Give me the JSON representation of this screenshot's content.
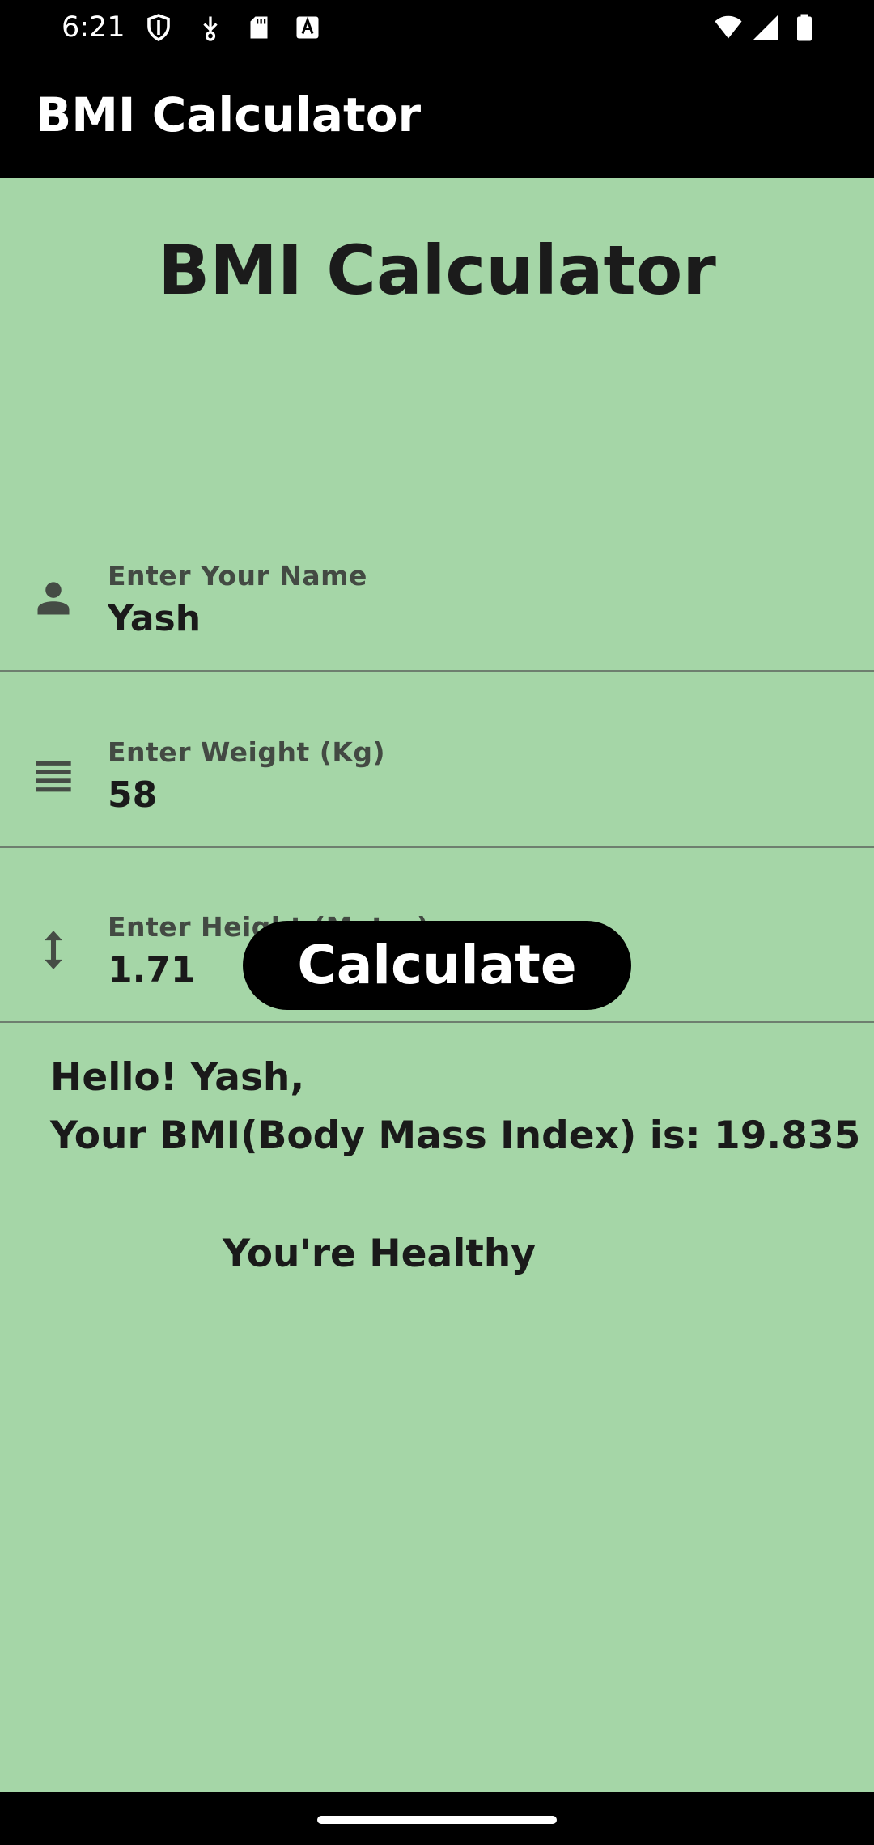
{
  "status_bar": {
    "time": "6:21",
    "left_icons": [
      "shield-icon",
      "usb-icon",
      "sd-card-icon",
      "text-icon"
    ],
    "right_icons": [
      "wifi-icon",
      "signal-icon",
      "battery-icon"
    ]
  },
  "app_bar": {
    "title": "BMI Calculator"
  },
  "main": {
    "title": "BMI Calculator",
    "fields": [
      {
        "label": "Enter Your Name",
        "value": "Yash",
        "icon": "person-icon"
      },
      {
        "label": "Enter Weight (Kg)",
        "value": "58",
        "icon": "weight-lines-icon"
      },
      {
        "label": "Enter Height (Meter)",
        "value": "1.71",
        "icon": "height-arrows-icon"
      }
    ],
    "calculate_label": "Calculate",
    "result": {
      "greeting": "Hello! Yash,",
      "bmi_line": "Your BMI(Body Mass Index) is: 19.835",
      "status": "You're Healthy"
    }
  },
  "colors": {
    "background": "#a5d6a7",
    "app_bar": "#000000",
    "button": "#000000"
  }
}
